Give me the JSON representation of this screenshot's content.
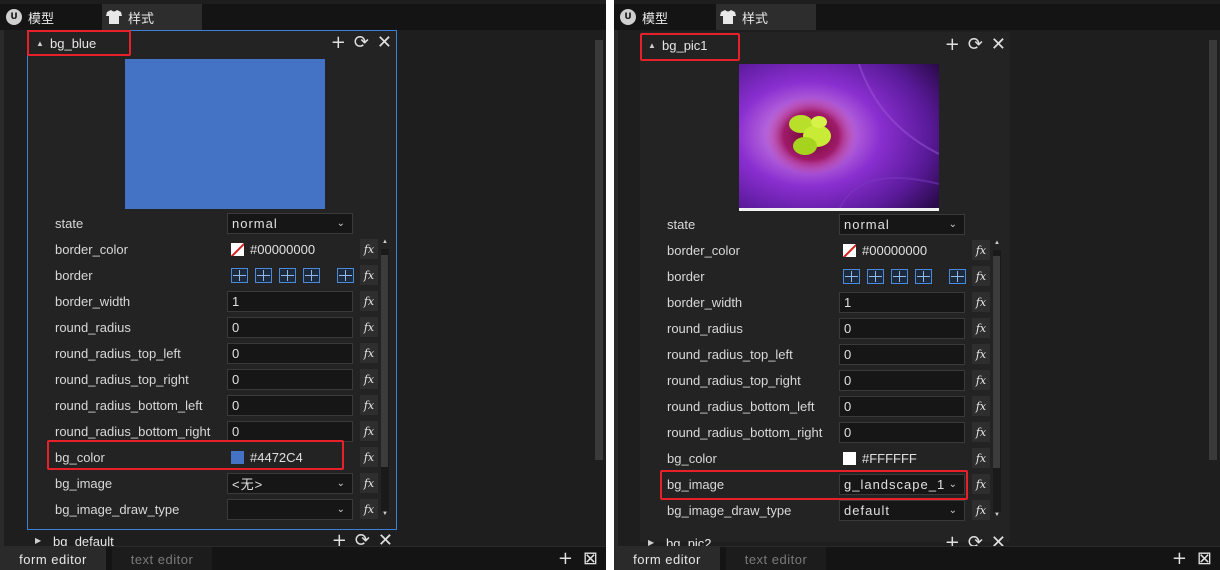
{
  "tabs": {
    "model": "模型",
    "style": "样式"
  },
  "bottom_tabs": {
    "form": "form editor",
    "text": "text editor"
  },
  "header_icons": [
    "add-icon",
    "refresh-icon",
    "close-icon"
  ],
  "colors": {
    "accent": "#3f7fd6",
    "highlight": "#e8202a",
    "preview_color": "#4472C4"
  },
  "left": {
    "title": "bg_blue",
    "next_title": "bg_default",
    "rows": [
      {
        "label": "state",
        "type": "select",
        "value": "normal"
      },
      {
        "label": "border_color",
        "type": "color",
        "value": "#00000000",
        "swatch": "none"
      },
      {
        "label": "border",
        "type": "border"
      },
      {
        "label": "border_width",
        "type": "text",
        "value": "1"
      },
      {
        "label": "round_radius",
        "type": "text",
        "value": "0"
      },
      {
        "label": "round_radius_top_left",
        "type": "text",
        "value": "0"
      },
      {
        "label": "round_radius_top_right",
        "type": "text",
        "value": "0"
      },
      {
        "label": "round_radius_bottom_left",
        "type": "text",
        "value": "0"
      },
      {
        "label": "round_radius_bottom_right",
        "type": "text",
        "value": "0"
      },
      {
        "label": "bg_color",
        "type": "color",
        "value": "#4472C4",
        "swatch": "#4472C4"
      },
      {
        "label": "bg_image",
        "type": "select",
        "value": "<无>"
      },
      {
        "label": "bg_image_draw_type",
        "type": "select",
        "value": ""
      }
    ]
  },
  "right": {
    "title": "bg_pic1",
    "next_title": "bg_pic2",
    "rows": [
      {
        "label": "state",
        "type": "select",
        "value": "normal"
      },
      {
        "label": "border_color",
        "type": "color",
        "value": "#00000000",
        "swatch": "none"
      },
      {
        "label": "border",
        "type": "border"
      },
      {
        "label": "border_width",
        "type": "text",
        "value": "1"
      },
      {
        "label": "round_radius",
        "type": "text",
        "value": "0"
      },
      {
        "label": "round_radius_top_left",
        "type": "text",
        "value": "0"
      },
      {
        "label": "round_radius_top_right",
        "type": "text",
        "value": "0"
      },
      {
        "label": "round_radius_bottom_left",
        "type": "text",
        "value": "0"
      },
      {
        "label": "round_radius_bottom_right",
        "type": "text",
        "value": "0"
      },
      {
        "label": "bg_color",
        "type": "color",
        "value": "#FFFFFF",
        "swatch": "#FFFFFF"
      },
      {
        "label": "bg_image",
        "type": "select",
        "value": "g_landscape_1"
      },
      {
        "label": "bg_image_draw_type",
        "type": "select",
        "value": "default"
      }
    ]
  }
}
